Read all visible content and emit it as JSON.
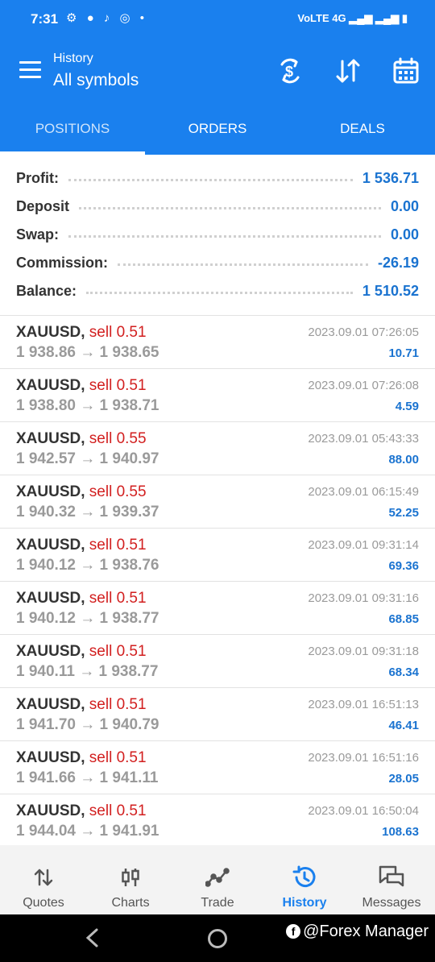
{
  "status_bar": {
    "time": "7:31",
    "left_icons": "⚙ ● ♪ ◎ •",
    "right_icons": "VoLTE 4G ▂▄▆ ▂▄▆ ▮"
  },
  "app_bar": {
    "subtitle": "History",
    "title": "All symbols",
    "icons": [
      "menu-icon",
      "currency-exchange-icon",
      "sort-icon",
      "calendar-icon"
    ]
  },
  "tabs": [
    {
      "label": "POSITIONS",
      "active": true
    },
    {
      "label": "ORDERS",
      "active": false
    },
    {
      "label": "DEALS",
      "active": false
    }
  ],
  "summary": [
    {
      "label": "Profit:",
      "value": "1 536.71"
    },
    {
      "label": "Deposit",
      "value": "0.00"
    },
    {
      "label": "Swap:",
      "value": "0.00"
    },
    {
      "label": "Commission:",
      "value": "-26.19"
    },
    {
      "label": "Balance:",
      "value": "1 510.52"
    }
  ],
  "deals": [
    {
      "symbol": "XAUUSD,",
      "side": "sell 0.51",
      "open": "1 938.86",
      "arrow": "→",
      "close": "1 938.65",
      "time": "2023.09.01 07:26:05",
      "profit": "10.71"
    },
    {
      "symbol": "XAUUSD,",
      "side": "sell 0.51",
      "open": "1 938.80",
      "arrow": "→",
      "close": "1 938.71",
      "time": "2023.09.01 07:26:08",
      "profit": "4.59"
    },
    {
      "symbol": "XAUUSD,",
      "side": "sell 0.55",
      "open": "1 942.57",
      "arrow": "→",
      "close": "1 940.97",
      "time": "2023.09.01 05:43:33",
      "profit": "88.00"
    },
    {
      "symbol": "XAUUSD,",
      "side": "sell 0.55",
      "open": "1 940.32",
      "arrow": "→",
      "close": "1 939.37",
      "time": "2023.09.01 06:15:49",
      "profit": "52.25"
    },
    {
      "symbol": "XAUUSD,",
      "side": "sell 0.51",
      "open": "1 940.12",
      "arrow": "→",
      "close": "1 938.76",
      "time": "2023.09.01 09:31:14",
      "profit": "69.36"
    },
    {
      "symbol": "XAUUSD,",
      "side": "sell 0.51",
      "open": "1 940.12",
      "arrow": "→",
      "close": "1 938.77",
      "time": "2023.09.01 09:31:16",
      "profit": "68.85"
    },
    {
      "symbol": "XAUUSD,",
      "side": "sell 0.51",
      "open": "1 940.11",
      "arrow": "→",
      "close": "1 938.77",
      "time": "2023.09.01 09:31:18",
      "profit": "68.34"
    },
    {
      "symbol": "XAUUSD,",
      "side": "sell 0.51",
      "open": "1 941.70",
      "arrow": "→",
      "close": "1 940.79",
      "time": "2023.09.01 16:51:13",
      "profit": "46.41"
    },
    {
      "symbol": "XAUUSD,",
      "side": "sell 0.51",
      "open": "1 941.66",
      "arrow": "→",
      "close": "1 941.11",
      "time": "2023.09.01 16:51:16",
      "profit": "28.05"
    },
    {
      "symbol": "XAUUSD,",
      "side": "sell 0.51",
      "open": "1 944.04",
      "arrow": "→",
      "close": "1 941.91",
      "time": "2023.09.01 16:50:04",
      "profit": "108.63"
    }
  ],
  "bottom_nav": [
    {
      "label": "Quotes",
      "icon": "quotes-icon",
      "active": false
    },
    {
      "label": "Charts",
      "icon": "charts-icon",
      "active": false
    },
    {
      "label": "Trade",
      "icon": "trade-icon",
      "active": false
    },
    {
      "label": "History",
      "icon": "history-icon",
      "active": true
    },
    {
      "label": "Messages",
      "icon": "messages-icon",
      "active": false
    }
  ],
  "watermark": {
    "icon_letter": "f",
    "text": "@Forex Manager"
  },
  "colors": {
    "primary": "#1a80ee",
    "profit": "#1a73d0",
    "sell": "#d21f1f",
    "muted": "#9a9a9a"
  }
}
